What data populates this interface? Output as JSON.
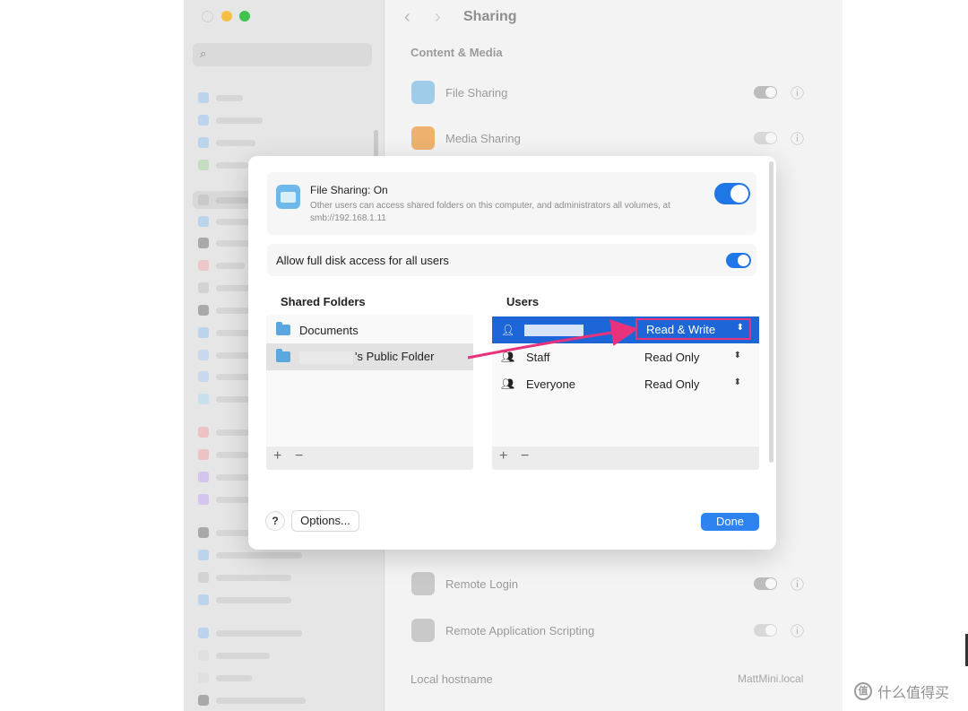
{
  "window": {
    "title": "Sharing",
    "section": "Content & Media",
    "rows": [
      {
        "label": "File Sharing",
        "icon": "file-sharing-icon",
        "color": "#7cc3ea"
      },
      {
        "label": "Media Sharing",
        "icon": "media-sharing-icon",
        "color": "#f0a64b"
      }
    ],
    "bottom_rows": [
      {
        "label": "Remote Login",
        "icon": "terminal-icon",
        "color": "#9a9a9a"
      },
      {
        "label": "Remote Application Scripting",
        "icon": "script-icon",
        "color": "#9a9a9a"
      }
    ],
    "hostname_label": "Local hostname",
    "hostname_value": "MattMini.local"
  },
  "dialog": {
    "title": "File Sharing: On",
    "description": "Other users can access shared folders on this computer, and administrators all volumes, at smb://192.168.1.11",
    "full_disk_label": "Allow full disk access for all users",
    "shared_folders_header": "Shared Folders",
    "users_header": "Users",
    "folders": [
      {
        "name": "Documents",
        "selected": false
      },
      {
        "name": "'s Public Folder",
        "selected": true
      }
    ],
    "users": [
      {
        "name": "",
        "permission": "Read & Write",
        "selected": true,
        "icon": "user-icon"
      },
      {
        "name": "Staff",
        "permission": "Read Only",
        "selected": false,
        "icon": "group-icon"
      },
      {
        "name": "Everyone",
        "permission": "Read Only",
        "selected": false,
        "icon": "everyone-icon"
      }
    ],
    "plus": "+",
    "minus": "−",
    "help": "?",
    "options": "Options...",
    "done": "Done"
  },
  "watermark": {
    "logo": "值",
    "text": "什么值得买"
  },
  "colors": {
    "accent": "#1f76e6",
    "highlight": "#e8327c"
  }
}
